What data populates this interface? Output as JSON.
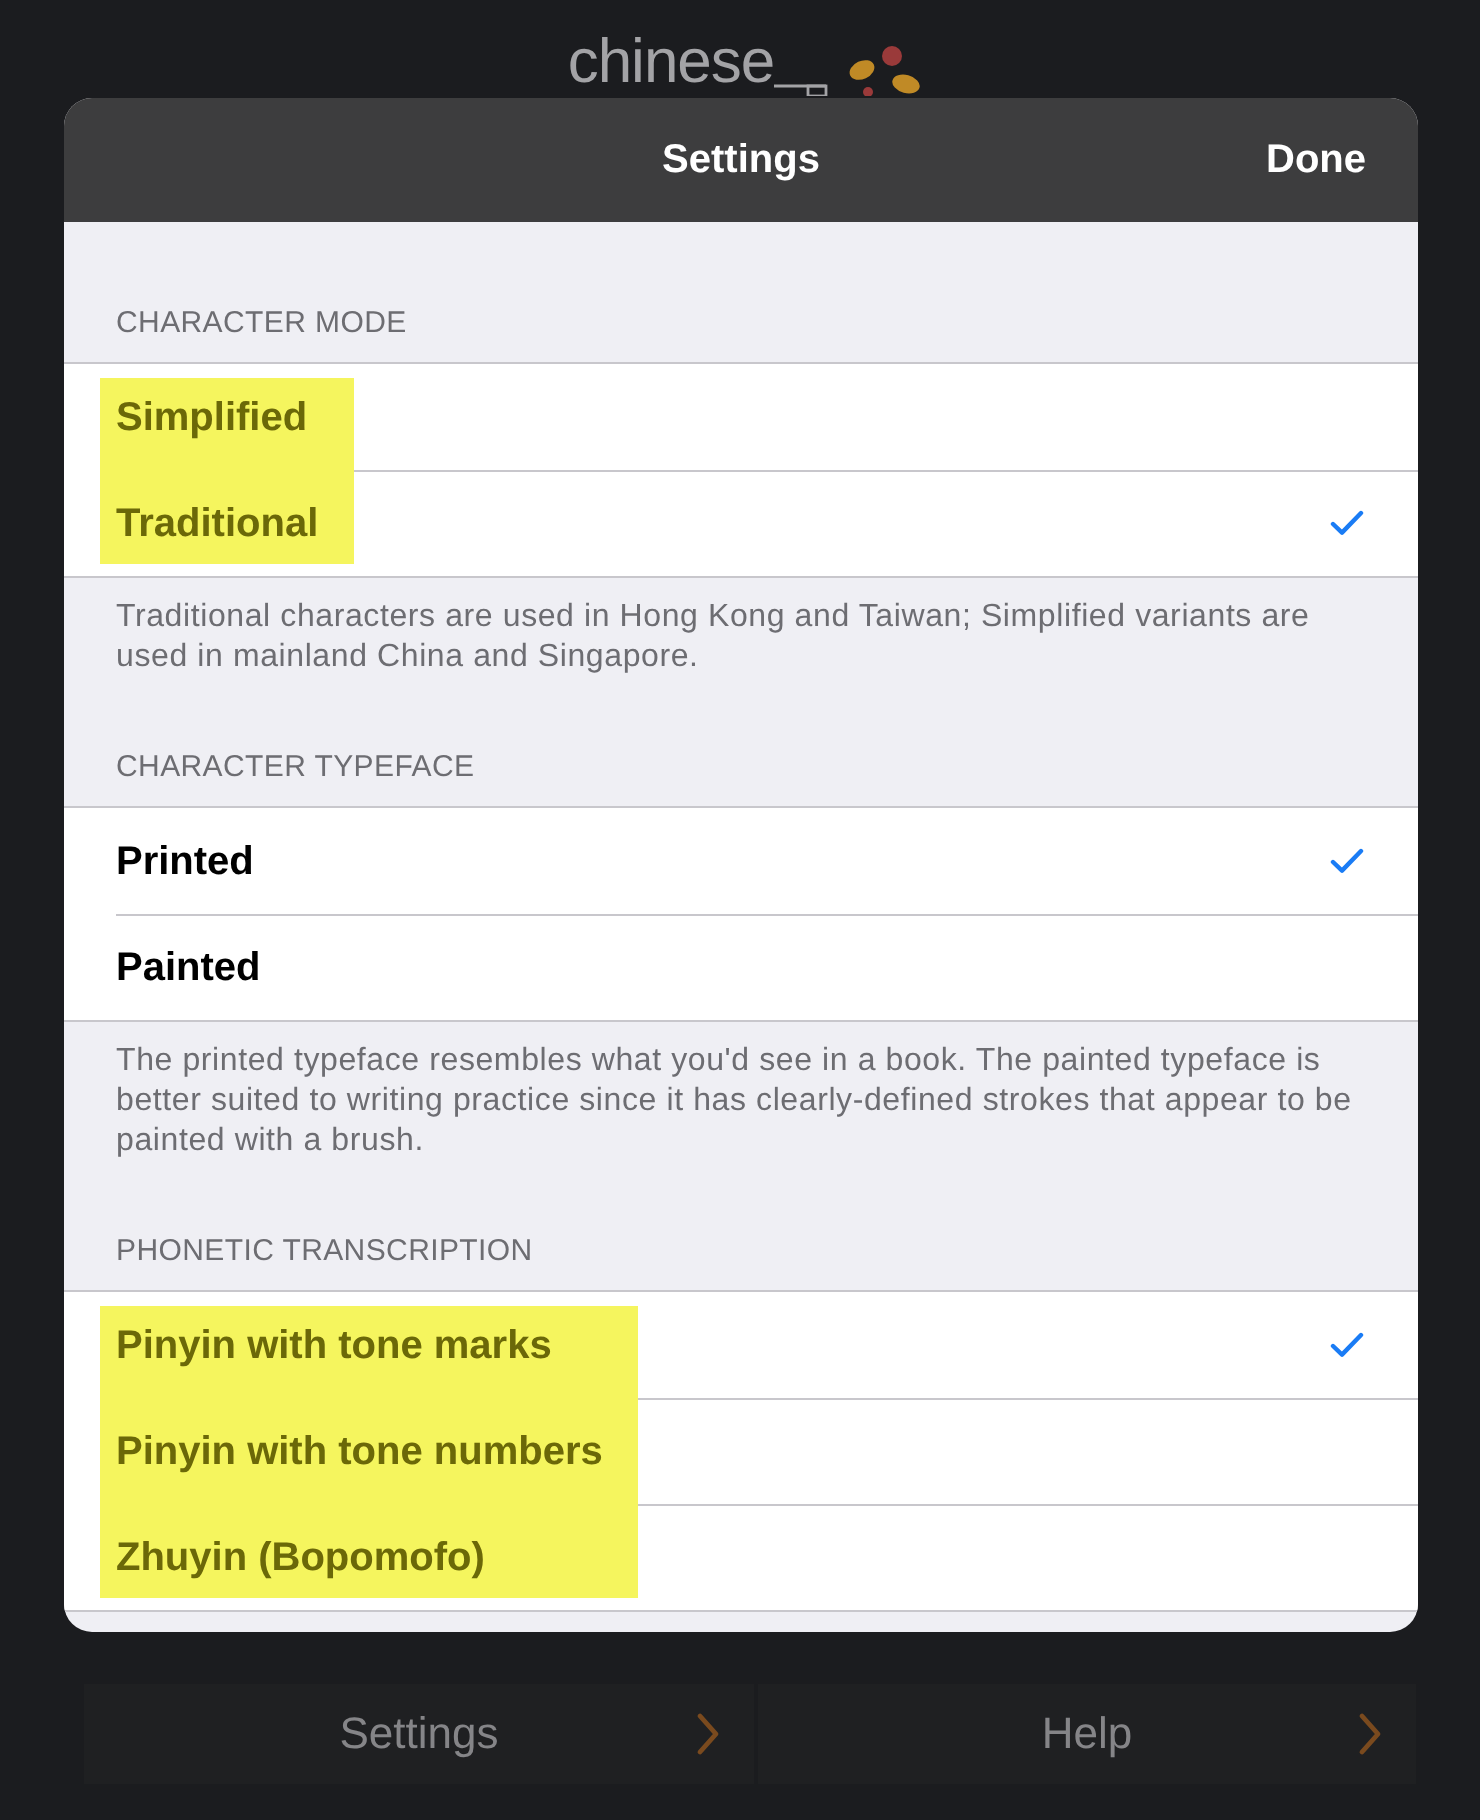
{
  "background": {
    "logo": {
      "text": "chinese"
    },
    "menu": [
      {
        "label": "Settings"
      },
      {
        "label": "Help"
      }
    ]
  },
  "sheet": {
    "title": "Settings",
    "done_button": "Done",
    "sections": [
      {
        "header": "CHARACTER MODE",
        "rows": [
          {
            "label": "Simplified",
            "selected": false,
            "highlighted": true
          },
          {
            "label": "Traditional",
            "selected": true,
            "highlighted": true
          }
        ],
        "footer": "Traditional characters are used in Hong Kong and Taiwan; Simplified variants are used in mainland China and Singapore."
      },
      {
        "header": "CHARACTER TYPEFACE",
        "rows": [
          {
            "label": "Printed",
            "selected": true,
            "highlighted": false
          },
          {
            "label": "Painted",
            "selected": false,
            "highlighted": false
          }
        ],
        "footer": "The printed typeface resembles what you'd see in a book. The painted typeface is better suited to writing practice since it has clearly-defined strokes that appear to be painted with a brush."
      },
      {
        "header": "PHONETIC TRANSCRIPTION",
        "rows": [
          {
            "label": "Pinyin with tone marks",
            "selected": true,
            "highlighted": true
          },
          {
            "label": "Pinyin with tone numbers",
            "selected": false,
            "highlighted": true
          },
          {
            "label": "Zhuyin (Bopomofo)",
            "selected": false,
            "highlighted": true
          }
        ]
      }
    ]
  }
}
